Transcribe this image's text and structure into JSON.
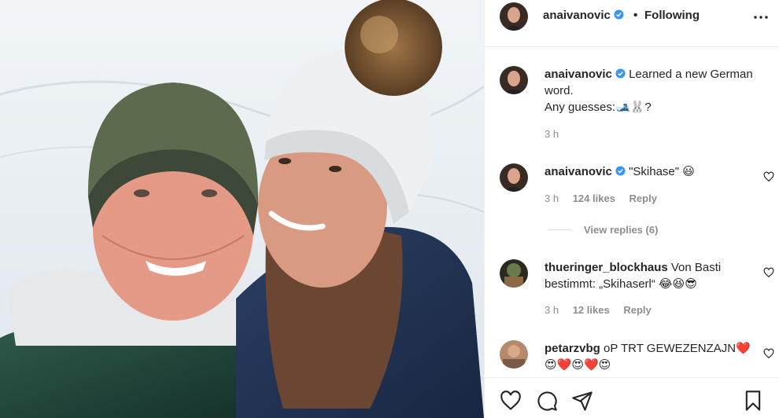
{
  "post": {
    "photo_alt": "selfie-photo",
    "author": "anaivanovic",
    "separator": "•",
    "follow_status": "Following"
  },
  "caption": {
    "author": "anaivanovic",
    "text_line1": "Learned a new German word.",
    "text_line2": "Any guesses:🎿🐰?",
    "time": "3 h"
  },
  "comments": [
    {
      "author": "anaivanovic",
      "text": "\"Skihase\" 😃",
      "time": "3 h",
      "likes": "124 likes",
      "reply": "Reply",
      "view_replies": "View replies (6)"
    },
    {
      "author": "thueringer_blockhaus",
      "text": "Von Basti bestimmt: „Skihaserl“ 😂😆😎",
      "time": "3 h",
      "likes": "12 likes",
      "reply": "Reply"
    },
    {
      "author": "petarzvbg",
      "text": "oP TRT GEWEZENZAJN❤️😍❤️😍❤️😍"
    }
  ],
  "colors": {
    "verified": "#3897f0",
    "text": "#262626",
    "muted": "#8e8e8e",
    "border": "#efefef"
  },
  "icons": [
    "heart-icon",
    "comment-icon",
    "share-icon",
    "bookmark-icon",
    "more-icon",
    "verified-badge-icon"
  ]
}
